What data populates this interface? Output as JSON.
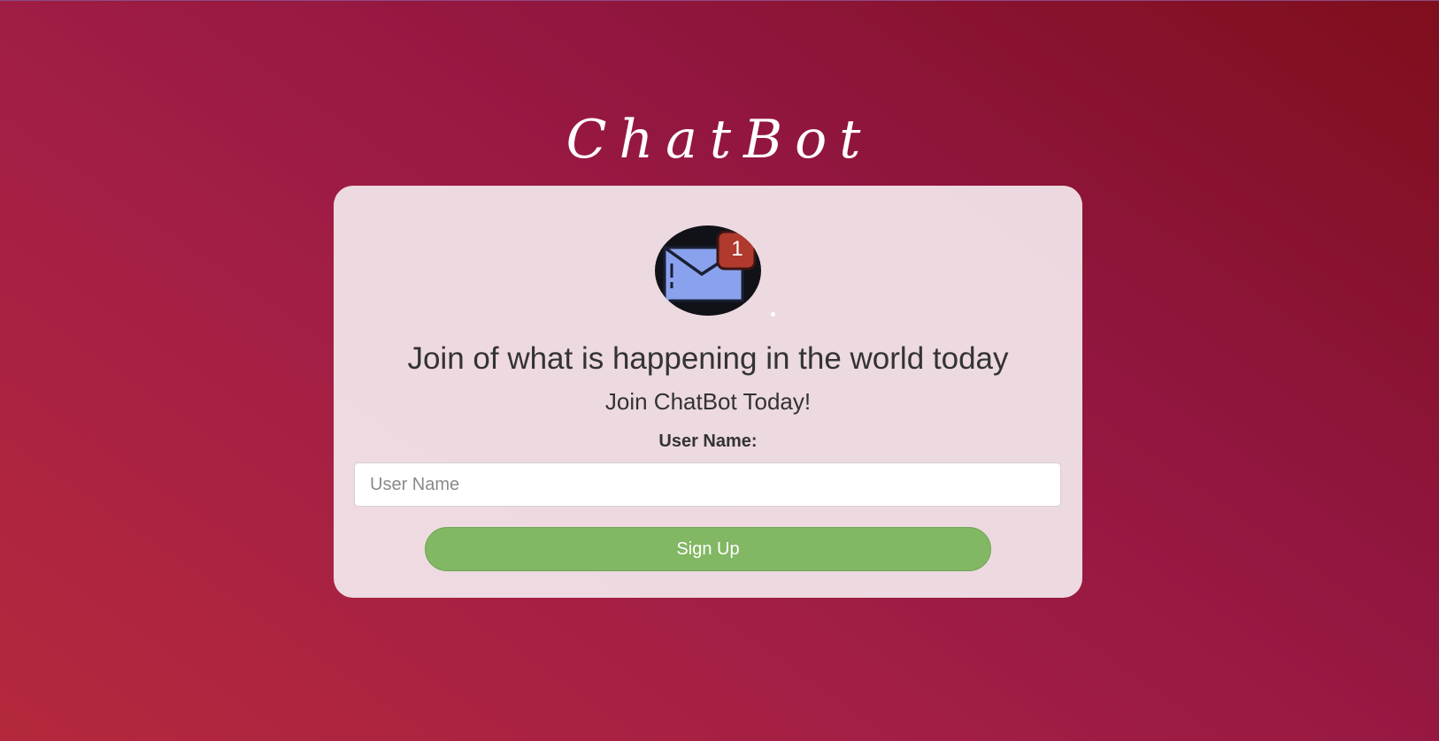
{
  "app": {
    "title": "ChatBot"
  },
  "card": {
    "logo_icon": "mail-notification-icon",
    "notification_count": "1",
    "headline": "Join of what is happening in the world today",
    "subheadline": "Join ChatBot Today!",
    "username_label": "User Name:",
    "username_placeholder": "User Name",
    "username_value": "",
    "signup_label": "Sign Up"
  },
  "colors": {
    "background_start": "#b5283c",
    "background_end": "#7f0e1c",
    "card": "#efe0e6",
    "button": "#82b763",
    "badge": "#b03a2e",
    "envelope": "#8aa2ee"
  }
}
